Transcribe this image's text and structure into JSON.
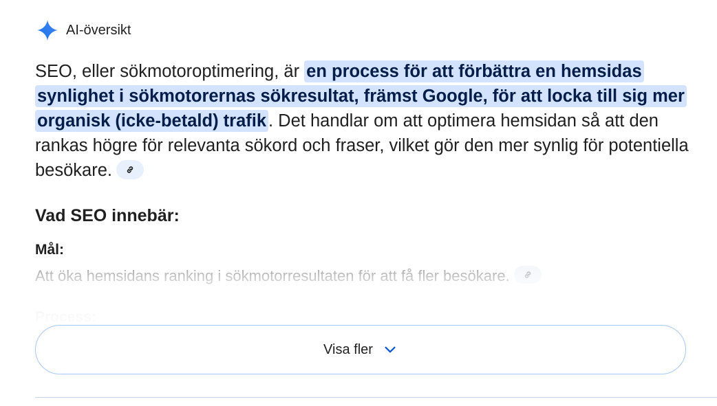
{
  "overview": {
    "title": "AI-översikt",
    "spark_icon": "gemini-spark-icon",
    "accent_color": "#4285f4"
  },
  "summary": {
    "intro": "SEO, eller sökmotoroptimering, är ",
    "highlight": "en process för att förbättra en hemsidas synlighet i sökmotorernas sökresultat, främst Google, för att locka till sig mer organisk (icke-betald) trafik",
    "rest": ". Det handlar om att optimera hemsidan så att den rankas högre för relevanta sökord och fraser, vilket gör den mer synlig för potentiella besökare.",
    "link_icon": "link-icon"
  },
  "section": {
    "heading": "Vad SEO innebär:",
    "goal_label": "Mål:",
    "goal_text": "Att öka hemsidans ranking i sökmotorresultaten för att få fler besökare.",
    "process_label": "Process:"
  },
  "show_more": {
    "label": "Visa fler",
    "icon": "chevron-down-icon"
  }
}
